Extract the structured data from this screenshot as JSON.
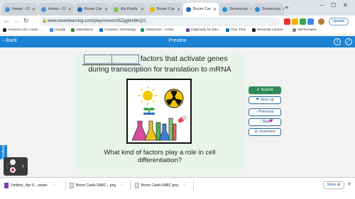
{
  "browser": {
    "tabs": [
      {
        "label": "Home - Cl",
        "color": "#4a8fd8"
      },
      {
        "label": "Home - Cl",
        "color": "#4a8fd8"
      },
      {
        "label": "Boom Car",
        "color": "#1a6fc0"
      },
      {
        "label": "My Produ",
        "color": "#8bc34a"
      },
      {
        "label": "Boom Car",
        "color": "#f0b400"
      },
      {
        "label": "Boom Car",
        "color": "#1a6fc0"
      },
      {
        "label": "Screencas",
        "color": "#2b8fd8"
      },
      {
        "label": "Screencas",
        "color": "#2b8fd8"
      }
    ],
    "new_tab": "+",
    "url": "www.boomlearning.com/play/mrwmAt5Zgg6rkBkQ/1",
    "update_label": "Update",
    "bookmarks": [
      {
        "label": "Amazon.com: Amaz...",
        "color": "#222"
      },
      {
        "label": "Google",
        "color": "#4285f4"
      },
      {
        "label": "Attendance",
        "color": "#3c8c3c"
      },
      {
        "label": "Courses | Schoology",
        "color": "#0b73b8"
      },
      {
        "label": "Classroom - Active",
        "color": "#0f9d58"
      },
      {
        "label": "Edgenuity for Edu...",
        "color": "#6b3fa0"
      },
      {
        "label": "True Time",
        "color": "#0b73b8"
      },
      {
        "label": "Newsela| Lesson...",
        "color": "#222"
      },
      {
        "label": "Stemscopes",
        "color": "#888"
      }
    ]
  },
  "boom": {
    "back_label": "Back",
    "title": "Preview",
    "info_icon": "i",
    "expand_icon": "⤢"
  },
  "card": {
    "line1": "factors that activate genes",
    "line2": "during transcription  for translation to mRNA",
    "question": "What kind of factors play a role in cell differentiation?"
  },
  "actions": {
    "submit": "Submit",
    "give_up": "Give up",
    "previous": "Previous",
    "skip": "Skip",
    "overview": "Overview"
  },
  "feedback_label": "Feedback",
  "downloads": {
    "items": [
      {
        "label": "Untitled_ Apr 6,...webm"
      },
      {
        "label": "Boom Cards 5ABC....png"
      },
      {
        "label": "Boom Cards 5ABC.png"
      }
    ],
    "show_all": "Show all",
    "close": "✕"
  },
  "colors": {
    "boom_blue": "#1a82d4",
    "submit_green": "#2e8b57",
    "card_bg": "#e9f3ec"
  }
}
